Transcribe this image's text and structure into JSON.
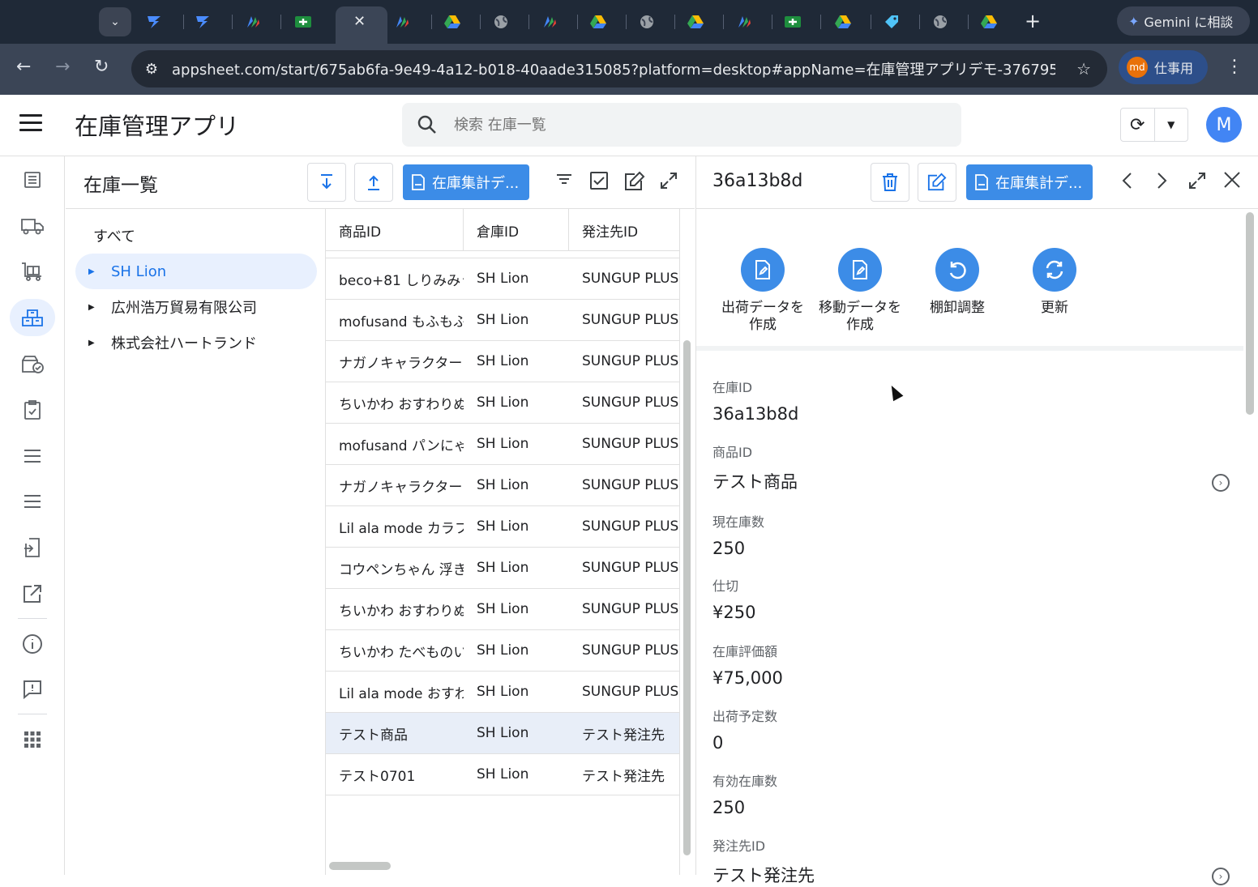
{
  "browser": {
    "new_tab": "+",
    "close_tab": "✕",
    "gemini_label": "Gemini に相談",
    "url": "appsheet.com/start/675ab6fa-9e49-4a12-b018-40aade315085?platform=desktop#appName=在庫管理アプリデモ-376795...",
    "profile_initials": "md",
    "profile_label": "仕事用"
  },
  "app": {
    "title": "在庫管理アプリ",
    "search_placeholder": "検索 在庫一覧",
    "user_initial": "M",
    "accent_color": "#3c8ce7"
  },
  "list": {
    "title": "在庫一覧",
    "export_button": "在庫集計デ...",
    "groups_all": "すべて",
    "groups": [
      {
        "label": "SH Lion",
        "active": true
      },
      {
        "label": "広州浩万貿易有限公司",
        "active": false
      },
      {
        "label": "株式会社ハートランド",
        "active": false
      }
    ],
    "columns": [
      "商品ID",
      "倉庫ID",
      "発注先ID"
    ],
    "rows": [
      {
        "product": "beco+81 しりみみう",
        "warehouse": "SH Lion",
        "supplier": "SUNGUP PLUS"
      },
      {
        "product": "mofusand もふもふ",
        "warehouse": "SH Lion",
        "supplier": "SUNGUP PLUS"
      },
      {
        "product": "ナガノキャラクター",
        "warehouse": "SH Lion",
        "supplier": "SUNGUP PLUS"
      },
      {
        "product": "ちいかわ おすわりぬ",
        "warehouse": "SH Lion",
        "supplier": "SUNGUP PLUS"
      },
      {
        "product": "mofusand パンにゃ",
        "warehouse": "SH Lion",
        "supplier": "SUNGUP PLUS"
      },
      {
        "product": "ナガノキャラクター",
        "warehouse": "SH Lion",
        "supplier": "SUNGUP PLUS"
      },
      {
        "product": "Lil ala mode カラフ",
        "warehouse": "SH Lion",
        "supplier": "SUNGUP PLUS"
      },
      {
        "product": "コウペンちゃん 浮き",
        "warehouse": "SH Lion",
        "supplier": "SUNGUP PLUS"
      },
      {
        "product": "ちいかわ おすわりぬ",
        "warehouse": "SH Lion",
        "supplier": "SUNGUP PLUS"
      },
      {
        "product": "ちいかわ たべものい",
        "warehouse": "SH Lion",
        "supplier": "SUNGUP PLUS"
      },
      {
        "product": "Lil ala mode おすわ",
        "warehouse": "SH Lion",
        "supplier": "SUNGUP PLUS"
      },
      {
        "product": "テスト商品",
        "warehouse": "SH Lion",
        "supplier": "テスト発注先",
        "selected": true
      },
      {
        "product": "テスト0701",
        "warehouse": "SH Lion",
        "supplier": "テスト発注先"
      }
    ]
  },
  "detail": {
    "title": "36a13b8d",
    "export_button": "在庫集計デ...",
    "actions": [
      {
        "label": "出荷データを\n作成",
        "icon": "file-edit-icon"
      },
      {
        "label": "移動データを\n作成",
        "icon": "file-edit-icon"
      },
      {
        "label": "棚卸調整",
        "icon": "undo-icon"
      },
      {
        "label": "更新",
        "icon": "refresh-icon"
      }
    ],
    "fields": [
      {
        "label": "在庫ID",
        "value": "36a13b8d"
      },
      {
        "label": "商品ID",
        "value": "テスト商品"
      },
      {
        "label": "現在庫数",
        "value": "250"
      },
      {
        "label": "仕切",
        "value": "¥250"
      },
      {
        "label": "在庫評価額",
        "value": "¥75,000"
      },
      {
        "label": "出荷予定数",
        "value": "0"
      },
      {
        "label": "有効在庫数",
        "value": "250"
      },
      {
        "label": "発注先ID",
        "value": "テスト発注先"
      }
    ]
  }
}
